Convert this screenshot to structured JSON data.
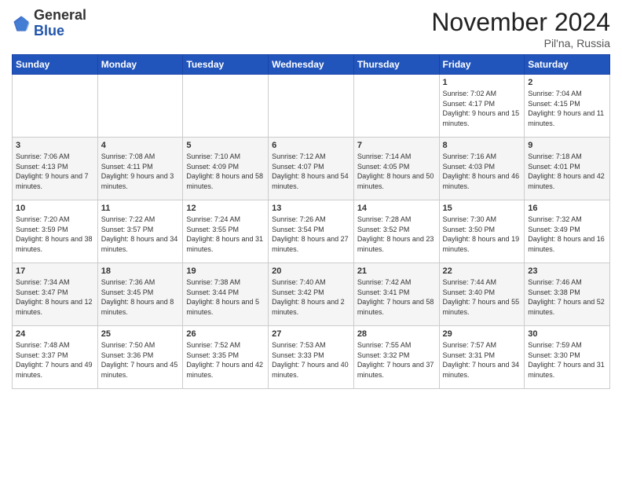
{
  "logo": {
    "general": "General",
    "blue": "Blue"
  },
  "header": {
    "month": "November 2024",
    "location": "Pil'na, Russia"
  },
  "weekdays": [
    "Sunday",
    "Monday",
    "Tuesday",
    "Wednesday",
    "Thursday",
    "Friday",
    "Saturday"
  ],
  "weeks": [
    [
      {
        "day": "",
        "info": ""
      },
      {
        "day": "",
        "info": ""
      },
      {
        "day": "",
        "info": ""
      },
      {
        "day": "",
        "info": ""
      },
      {
        "day": "",
        "info": ""
      },
      {
        "day": "1",
        "info": "Sunrise: 7:02 AM\nSunset: 4:17 PM\nDaylight: 9 hours and 15 minutes."
      },
      {
        "day": "2",
        "info": "Sunrise: 7:04 AM\nSunset: 4:15 PM\nDaylight: 9 hours and 11 minutes."
      }
    ],
    [
      {
        "day": "3",
        "info": "Sunrise: 7:06 AM\nSunset: 4:13 PM\nDaylight: 9 hours and 7 minutes."
      },
      {
        "day": "4",
        "info": "Sunrise: 7:08 AM\nSunset: 4:11 PM\nDaylight: 9 hours and 3 minutes."
      },
      {
        "day": "5",
        "info": "Sunrise: 7:10 AM\nSunset: 4:09 PM\nDaylight: 8 hours and 58 minutes."
      },
      {
        "day": "6",
        "info": "Sunrise: 7:12 AM\nSunset: 4:07 PM\nDaylight: 8 hours and 54 minutes."
      },
      {
        "day": "7",
        "info": "Sunrise: 7:14 AM\nSunset: 4:05 PM\nDaylight: 8 hours and 50 minutes."
      },
      {
        "day": "8",
        "info": "Sunrise: 7:16 AM\nSunset: 4:03 PM\nDaylight: 8 hours and 46 minutes."
      },
      {
        "day": "9",
        "info": "Sunrise: 7:18 AM\nSunset: 4:01 PM\nDaylight: 8 hours and 42 minutes."
      }
    ],
    [
      {
        "day": "10",
        "info": "Sunrise: 7:20 AM\nSunset: 3:59 PM\nDaylight: 8 hours and 38 minutes."
      },
      {
        "day": "11",
        "info": "Sunrise: 7:22 AM\nSunset: 3:57 PM\nDaylight: 8 hours and 34 minutes."
      },
      {
        "day": "12",
        "info": "Sunrise: 7:24 AM\nSunset: 3:55 PM\nDaylight: 8 hours and 31 minutes."
      },
      {
        "day": "13",
        "info": "Sunrise: 7:26 AM\nSunset: 3:54 PM\nDaylight: 8 hours and 27 minutes."
      },
      {
        "day": "14",
        "info": "Sunrise: 7:28 AM\nSunset: 3:52 PM\nDaylight: 8 hours and 23 minutes."
      },
      {
        "day": "15",
        "info": "Sunrise: 7:30 AM\nSunset: 3:50 PM\nDaylight: 8 hours and 19 minutes."
      },
      {
        "day": "16",
        "info": "Sunrise: 7:32 AM\nSunset: 3:49 PM\nDaylight: 8 hours and 16 minutes."
      }
    ],
    [
      {
        "day": "17",
        "info": "Sunrise: 7:34 AM\nSunset: 3:47 PM\nDaylight: 8 hours and 12 minutes."
      },
      {
        "day": "18",
        "info": "Sunrise: 7:36 AM\nSunset: 3:45 PM\nDaylight: 8 hours and 8 minutes."
      },
      {
        "day": "19",
        "info": "Sunrise: 7:38 AM\nSunset: 3:44 PM\nDaylight: 8 hours and 5 minutes."
      },
      {
        "day": "20",
        "info": "Sunrise: 7:40 AM\nSunset: 3:42 PM\nDaylight: 8 hours and 2 minutes."
      },
      {
        "day": "21",
        "info": "Sunrise: 7:42 AM\nSunset: 3:41 PM\nDaylight: 7 hours and 58 minutes."
      },
      {
        "day": "22",
        "info": "Sunrise: 7:44 AM\nSunset: 3:40 PM\nDaylight: 7 hours and 55 minutes."
      },
      {
        "day": "23",
        "info": "Sunrise: 7:46 AM\nSunset: 3:38 PM\nDaylight: 7 hours and 52 minutes."
      }
    ],
    [
      {
        "day": "24",
        "info": "Sunrise: 7:48 AM\nSunset: 3:37 PM\nDaylight: 7 hours and 49 minutes."
      },
      {
        "day": "25",
        "info": "Sunrise: 7:50 AM\nSunset: 3:36 PM\nDaylight: 7 hours and 45 minutes."
      },
      {
        "day": "26",
        "info": "Sunrise: 7:52 AM\nSunset: 3:35 PM\nDaylight: 7 hours and 42 minutes."
      },
      {
        "day": "27",
        "info": "Sunrise: 7:53 AM\nSunset: 3:33 PM\nDaylight: 7 hours and 40 minutes."
      },
      {
        "day": "28",
        "info": "Sunrise: 7:55 AM\nSunset: 3:32 PM\nDaylight: 7 hours and 37 minutes."
      },
      {
        "day": "29",
        "info": "Sunrise: 7:57 AM\nSunset: 3:31 PM\nDaylight: 7 hours and 34 minutes."
      },
      {
        "day": "30",
        "info": "Sunrise: 7:59 AM\nSunset: 3:30 PM\nDaylight: 7 hours and 31 minutes."
      }
    ]
  ]
}
